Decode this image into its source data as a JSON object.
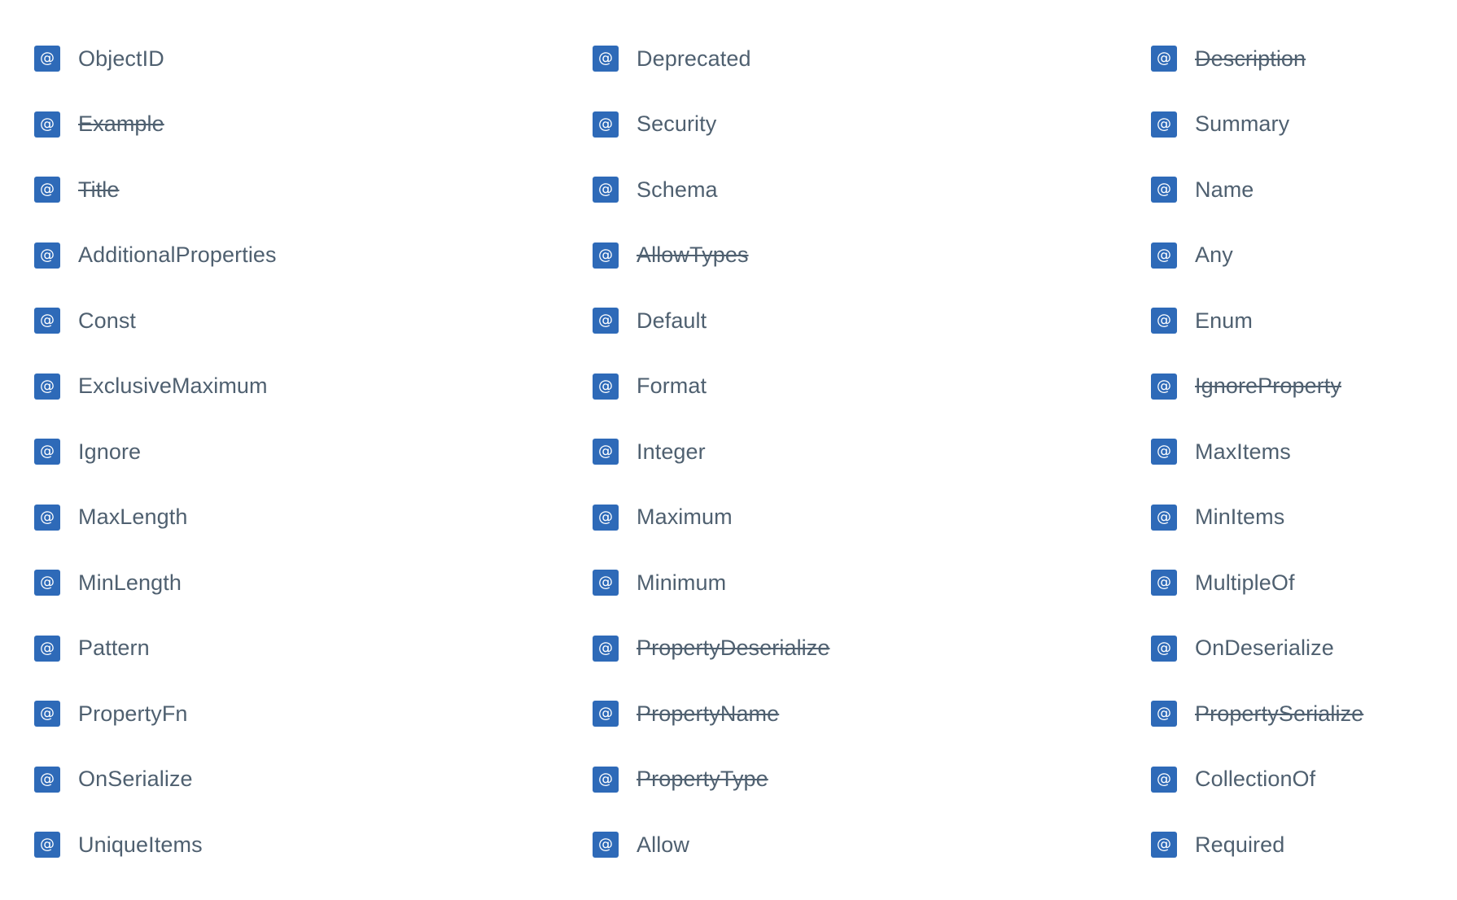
{
  "icon": {
    "name": "at-icon",
    "glyph": "@",
    "color": "#2e6ab8"
  },
  "annotations": [
    {
      "label": "ObjectID",
      "deprecated": false
    },
    {
      "label": "Deprecated",
      "deprecated": false
    },
    {
      "label": "Description",
      "deprecated": true
    },
    {
      "label": "Example",
      "deprecated": true
    },
    {
      "label": "Security",
      "deprecated": false
    },
    {
      "label": "Summary",
      "deprecated": false
    },
    {
      "label": "Title",
      "deprecated": true
    },
    {
      "label": "Schema",
      "deprecated": false
    },
    {
      "label": "Name",
      "deprecated": false
    },
    {
      "label": "AdditionalProperties",
      "deprecated": false
    },
    {
      "label": "AllowTypes",
      "deprecated": true
    },
    {
      "label": "Any",
      "deprecated": false
    },
    {
      "label": "Const",
      "deprecated": false
    },
    {
      "label": "Default",
      "deprecated": false
    },
    {
      "label": "Enum",
      "deprecated": false
    },
    {
      "label": "ExclusiveMaximum",
      "deprecated": false
    },
    {
      "label": "Format",
      "deprecated": false
    },
    {
      "label": "IgnoreProperty",
      "deprecated": true
    },
    {
      "label": "Ignore",
      "deprecated": false
    },
    {
      "label": "Integer",
      "deprecated": false
    },
    {
      "label": "MaxItems",
      "deprecated": false
    },
    {
      "label": "MaxLength",
      "deprecated": false
    },
    {
      "label": "Maximum",
      "deprecated": false
    },
    {
      "label": "MinItems",
      "deprecated": false
    },
    {
      "label": "MinLength",
      "deprecated": false
    },
    {
      "label": "Minimum",
      "deprecated": false
    },
    {
      "label": "MultipleOf",
      "deprecated": false
    },
    {
      "label": "Pattern",
      "deprecated": false
    },
    {
      "label": "PropertyDeserialize",
      "deprecated": true
    },
    {
      "label": "OnDeserialize",
      "deprecated": false
    },
    {
      "label": "PropertyFn",
      "deprecated": false
    },
    {
      "label": "PropertyName",
      "deprecated": true
    },
    {
      "label": "PropertySerialize",
      "deprecated": true
    },
    {
      "label": "OnSerialize",
      "deprecated": false
    },
    {
      "label": "PropertyType",
      "deprecated": true
    },
    {
      "label": "CollectionOf",
      "deprecated": false
    },
    {
      "label": "UniqueItems",
      "deprecated": false
    },
    {
      "label": "Allow",
      "deprecated": false
    },
    {
      "label": "Required",
      "deprecated": false
    }
  ]
}
